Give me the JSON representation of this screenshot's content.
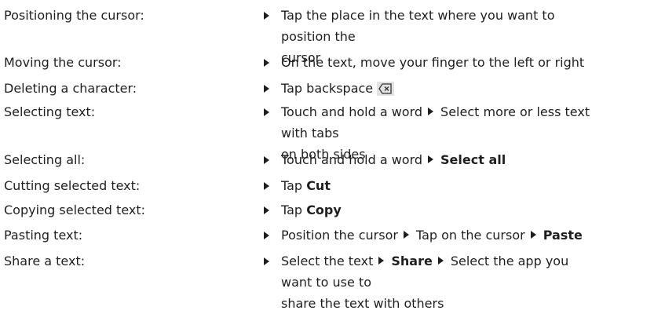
{
  "rows": [
    {
      "label": "Positioning the cursor:",
      "line1": "Tap the place in the text where you want to position the",
      "line2": "cursor"
    },
    {
      "label": "Moving the cursor:",
      "text": "On the text, move your finger to the left or right"
    },
    {
      "label": "Deleting a character:",
      "text": "Tap backspace",
      "icon": "backspace-icon"
    },
    {
      "label": "Selecting text:",
      "step1": "Touch and hold a word",
      "step2_line1": "Select more or less text with tabs",
      "step2_line2": "on both sides"
    },
    {
      "label": "Selecting all:",
      "step1": "Touch and hold a word",
      "step2": "Select all"
    },
    {
      "label": "Cutting selected text:",
      "prefix": "Tap",
      "bold": "Cut"
    },
    {
      "label": "Copying selected text:",
      "prefix": "Tap",
      "bold": "Copy"
    },
    {
      "label": "Pasting text:",
      "step1": "Position the cursor",
      "step2": "Tap on the cursor",
      "step3": "Paste"
    },
    {
      "label": "Share a text:",
      "step1": "Select the text",
      "step2": "Share",
      "step3_line1": "Select the app you want to use to",
      "step3_line2": "share the text with others"
    }
  ],
  "icons": {
    "bullet": "right-triangle-icon",
    "backspace": "backspace-icon"
  }
}
